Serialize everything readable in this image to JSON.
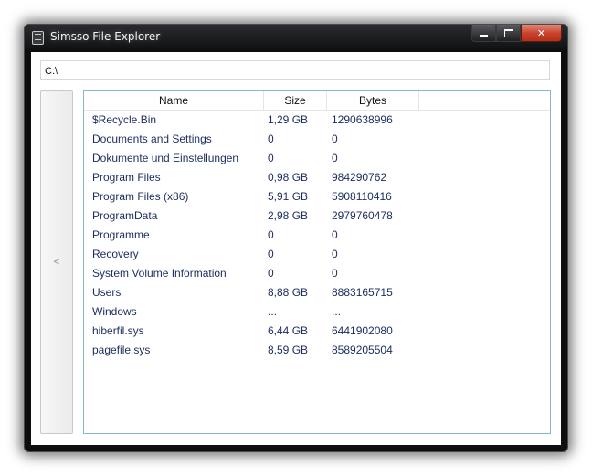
{
  "window": {
    "title": "Simsso File Explorer",
    "buttons": {
      "minimize": "",
      "maximize": "",
      "close": "✕"
    }
  },
  "path_bar": {
    "value": "C:\\"
  },
  "back_button": {
    "label": "<"
  },
  "file_list": {
    "columns": [
      "Name",
      "Size",
      "Bytes"
    ],
    "rows": [
      {
        "name": "$Recycle.Bin",
        "size": "1,29 GB",
        "bytes": "1290638996"
      },
      {
        "name": "Documents and Settings",
        "size": "0",
        "bytes": "0"
      },
      {
        "name": "Dokumente und Einstellungen",
        "size": "0",
        "bytes": "0"
      },
      {
        "name": "Program Files",
        "size": "0,98 GB",
        "bytes": "984290762"
      },
      {
        "name": "Program Files (x86)",
        "size": "5,91 GB",
        "bytes": "5908110416"
      },
      {
        "name": "ProgramData",
        "size": "2,98 GB",
        "bytes": "2979760478"
      },
      {
        "name": "Programme",
        "size": "0",
        "bytes": "0"
      },
      {
        "name": "Recovery",
        "size": "0",
        "bytes": "0"
      },
      {
        "name": "System Volume Information",
        "size": "0",
        "bytes": "0"
      },
      {
        "name": "Users",
        "size": "8,88 GB",
        "bytes": "8883165715"
      },
      {
        "name": "Windows",
        "size": "...",
        "bytes": "..."
      },
      {
        "name": "hiberfil.sys",
        "size": "6,44 GB",
        "bytes": "6441902080"
      },
      {
        "name": "pagefile.sys",
        "size": "8,59 GB",
        "bytes": "8589205504"
      }
    ]
  }
}
